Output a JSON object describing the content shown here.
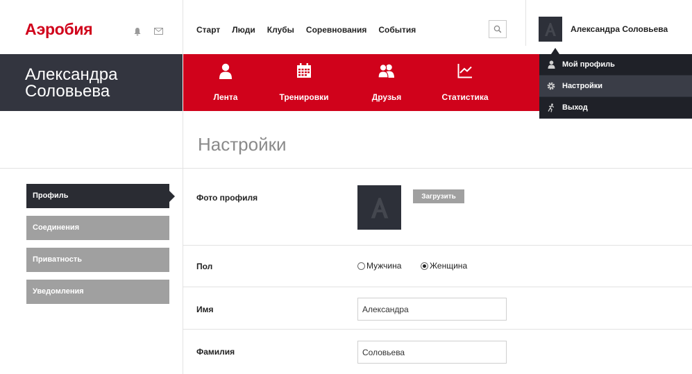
{
  "brand": {
    "logo_text": "Аэробия",
    "color": "#d0021b"
  },
  "header_icons": [
    "bell-icon",
    "envelope-icon"
  ],
  "nav": [
    "Старт",
    "Люди",
    "Клубы",
    "Соревнования",
    "События"
  ],
  "search": {
    "icon": "search-icon"
  },
  "user": {
    "name": "Александра Соловьева",
    "avatar_letter": "A"
  },
  "name_block": {
    "line1": "Александра",
    "line2": "Соловьева"
  },
  "red_nav": [
    {
      "label": "Лента",
      "icon": "person-icon"
    },
    {
      "label": "Тренировки",
      "icon": "calendar-icon"
    },
    {
      "label": "Друзья",
      "icon": "friends-icon"
    },
    {
      "label": "Статистика",
      "icon": "chart-icon"
    }
  ],
  "dropdown": [
    {
      "label": "Мой профиль",
      "icon": "person-icon"
    },
    {
      "label": "Настройки",
      "icon": "gear-icon",
      "highlighted": true
    },
    {
      "label": "Выход",
      "icon": "running-icon"
    }
  ],
  "page_title": "Настройки",
  "side_menu": [
    {
      "label": "Профиль",
      "active": true
    },
    {
      "label": "Соединения",
      "active": false
    },
    {
      "label": "Приватность",
      "active": false
    },
    {
      "label": "Уведомления",
      "active": false
    }
  ],
  "form": {
    "photo": {
      "label": "Фото профиля",
      "upload_button": "Загрузить",
      "avatar_letter": "A"
    },
    "gender": {
      "label": "Пол",
      "options": [
        "Мужчина",
        "Женщина"
      ],
      "selected": "Женщина"
    },
    "first_name": {
      "label": "Имя",
      "value": "Александра"
    },
    "last_name": {
      "label": "Фамилия",
      "value": "Соловьева"
    }
  },
  "colors": {
    "accent": "#d0021b",
    "dark": "#33353f",
    "menu_gray": "#a0a0a0"
  }
}
